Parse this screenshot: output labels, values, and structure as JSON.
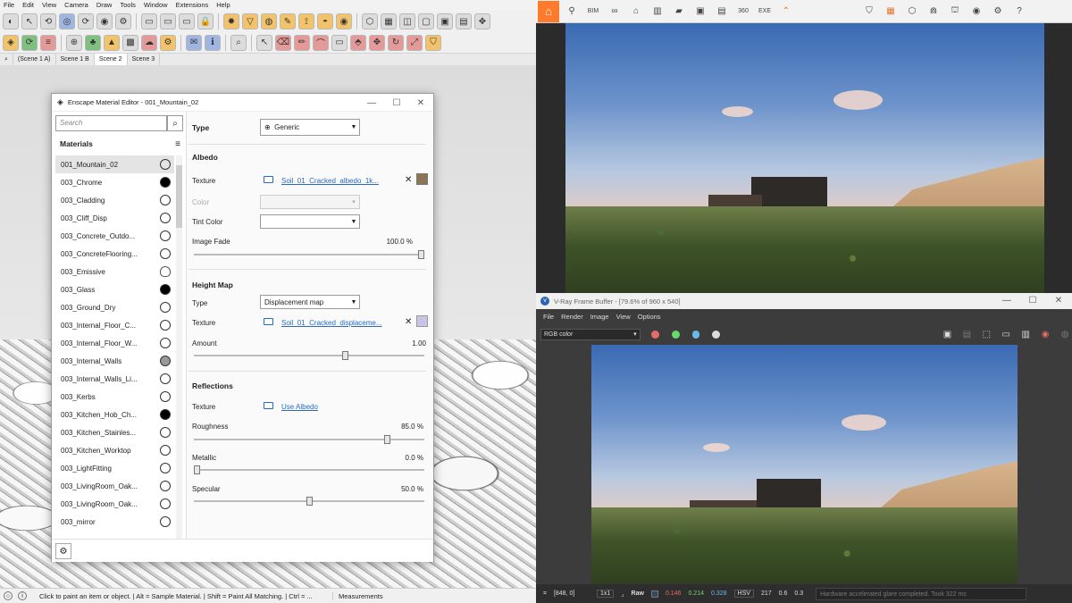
{
  "sketchup": {
    "menu": [
      "File",
      "Edit",
      "View",
      "Camera",
      "Draw",
      "Tools",
      "Window",
      "Extensions",
      "Help"
    ],
    "scenes": [
      "(Scene 1 A)",
      "Scene 1 B",
      "Scene 2",
      "Scene 3"
    ],
    "active_scene": "Scene 2",
    "status_text": "Click to paint an item or object. | Alt = Sample Material. | Shift = Paint All Matching. | Ctrl = ...",
    "measurements_label": "Measurements"
  },
  "material_editor": {
    "title": "Enscape Material Editor - 001_Mountain_02",
    "search_placeholder": "Search",
    "materials_header": "Materials",
    "materials": [
      {
        "name": "001_Mountain_02",
        "swatch": "empty",
        "selected": true
      },
      {
        "name": "003_Chrome",
        "swatch": "black"
      },
      {
        "name": "003_Cladding",
        "swatch": "empty"
      },
      {
        "name": "003_Cliff_Disp",
        "swatch": "empty"
      },
      {
        "name": "003_Concrete_Outdo...",
        "swatch": "empty"
      },
      {
        "name": "003_ConcreteFlooring...",
        "swatch": "empty"
      },
      {
        "name": "003_Emissive",
        "swatch": "bulb"
      },
      {
        "name": "003_Glass",
        "swatch": "black"
      },
      {
        "name": "003_Ground_Dry",
        "swatch": "empty"
      },
      {
        "name": "003_Internal_Floor_C...",
        "swatch": "empty"
      },
      {
        "name": "003_Internal_Floor_W...",
        "swatch": "empty"
      },
      {
        "name": "003_Internal_Walls",
        "swatch": "gray"
      },
      {
        "name": "003_Internal_Walls_Li...",
        "swatch": "empty"
      },
      {
        "name": "003_Kerbs",
        "swatch": "empty"
      },
      {
        "name": "003_Kitchen_Hob_Ch...",
        "swatch": "black"
      },
      {
        "name": "003_Kitchen_Stainles...",
        "swatch": "empty"
      },
      {
        "name": "003_Kitchen_Worktop",
        "swatch": "empty"
      },
      {
        "name": "003_LightFitting",
        "swatch": "empty"
      },
      {
        "name": "003_LivingRoom_Oak...",
        "swatch": "empty"
      },
      {
        "name": "003_LivingRoom_Oak...",
        "swatch": "empty"
      },
      {
        "name": "003_mirror",
        "swatch": "empty"
      }
    ],
    "type_label": "Type",
    "type_value": "Generic",
    "albedo": {
      "header": "Albedo",
      "texture_label": "Texture",
      "texture_file": "Soil_01_Cracked_albedo_1k...",
      "color_label": "Color",
      "tint_label": "Tint Color",
      "fade_label": "Image Fade",
      "fade_value": "100.0",
      "fade_unit": "%",
      "fade_fraction": 1.0,
      "swatch_color": "#8c7457"
    },
    "height_map": {
      "header": "Height Map",
      "type_label": "Type",
      "type_value": "Displacement map",
      "texture_label": "Texture",
      "texture_file": "Soil_01_Cracked_displaceme...",
      "amount_label": "Amount",
      "amount_value": "1.00",
      "amount_fraction": 0.66
    },
    "reflections": {
      "header": "Reflections",
      "texture_label": "Texture",
      "texture_link": "Use Albedo",
      "roughness_label": "Roughness",
      "roughness_value": "85.0",
      "roughness_fraction": 0.85,
      "metallic_label": "Metallic",
      "metallic_value": "0.0",
      "metallic_fraction": 0.0,
      "specular_label": "Specular",
      "specular_value": "50.0",
      "specular_fraction": 0.5,
      "unit": "%"
    }
  },
  "vray": {
    "title": "V-Ray Frame Buffer - [79.6% of 960 x 540]",
    "menu": [
      "File",
      "Render",
      "Image",
      "View",
      "Options"
    ],
    "channel": "RGB color",
    "status": {
      "coords": "[848, 0]",
      "zoom": "1x1",
      "mode": "Raw",
      "r": "0.146",
      "g": "0.214",
      "b": "0.328",
      "cspace": "HSV",
      "h": "217",
      "s": "0.6",
      "v": "0.3",
      "message": "Hardware accelerated glare completed. Took 322 ms"
    }
  },
  "colors": {
    "enscape_accent": "#ff7a2a",
    "link": "#2a6bbf"
  }
}
